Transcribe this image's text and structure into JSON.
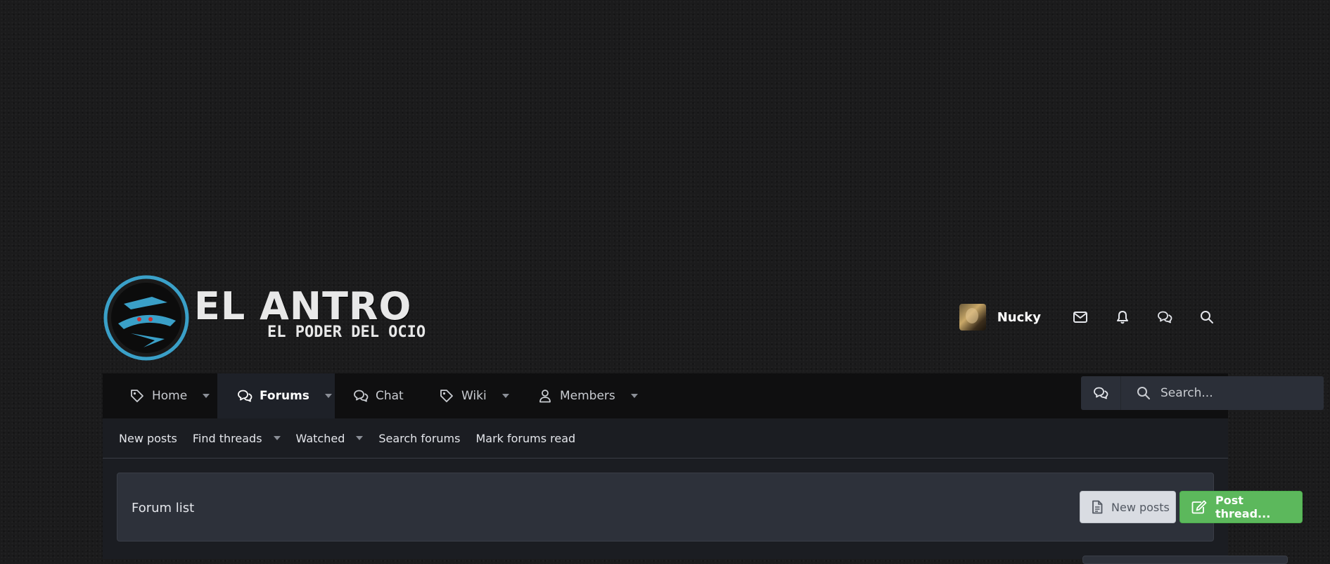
{
  "logo": {
    "title": "EL ANTRO",
    "subtitle": "EL PODER DEL OCIO"
  },
  "user": {
    "name": "Nucky"
  },
  "nav": {
    "tabs": [
      {
        "label": "Home",
        "icon": "tag-icon",
        "has_dropdown": true
      },
      {
        "label": "Forums",
        "icon": "comments-icon",
        "has_dropdown": true,
        "active": true
      },
      {
        "label": "Chat",
        "icon": "comments-icon",
        "has_dropdown": false
      },
      {
        "label": "Wiki",
        "icon": "tag-icon",
        "has_dropdown": true
      },
      {
        "label": "Members",
        "icon": "user-icon",
        "has_dropdown": true
      }
    ]
  },
  "search": {
    "placeholder": "Search..."
  },
  "subnav": {
    "items": [
      "New posts",
      "Find threads",
      "Watched",
      "Search forums",
      "Mark forums read"
    ]
  },
  "page": {
    "title": "Forum list",
    "new_posts_label": "New posts",
    "post_thread_label": "Post thread..."
  },
  "colors": {
    "accent_green": "#5cb85c",
    "nav_bg": "#0f0f10",
    "panel_bg": "#2d313a",
    "logo_blue": "#3aa0c8"
  }
}
